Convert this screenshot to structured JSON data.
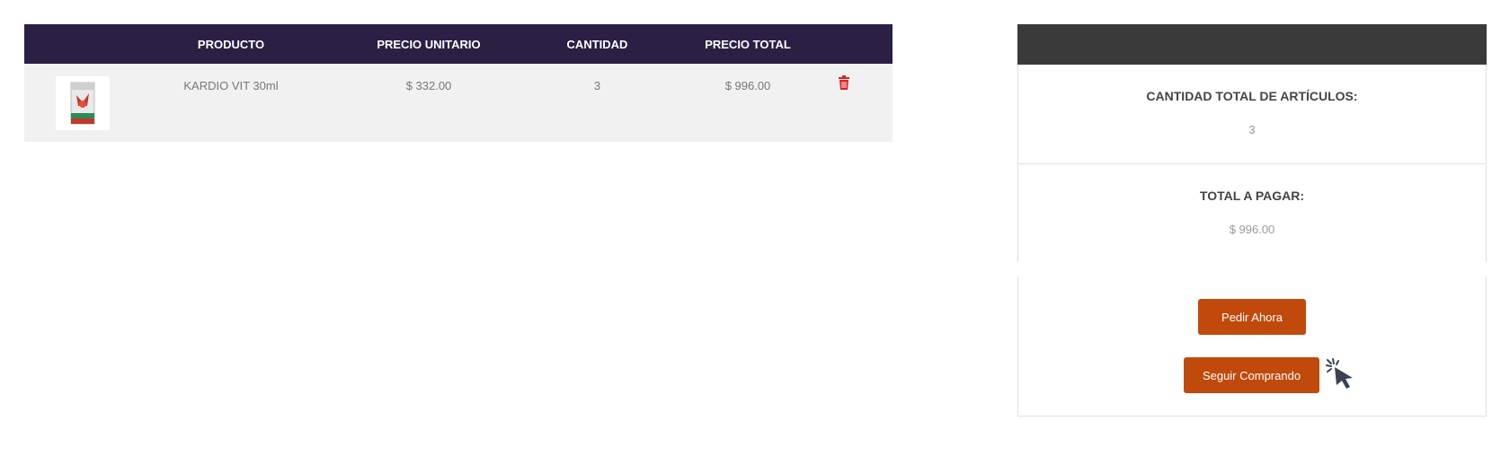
{
  "table": {
    "headers": {
      "producto": "PRODUCTO",
      "precio_unitario": "PRECIO UNITARIO",
      "cantidad": "CANTIDAD",
      "precio_total": "PRECIO TOTAL"
    },
    "rows": [
      {
        "product": "KARDIO VIT 30ml",
        "unit_price": "$ 332.00",
        "quantity": "3",
        "total_price": "$ 996.00"
      }
    ]
  },
  "summary": {
    "total_items_label": "CANTIDAD TOTAL DE ARTÍCULOS:",
    "total_items_value": "3",
    "total_pay_label": "TOTAL A PAGAR:",
    "total_pay_value": "$ 996.00",
    "order_button": "Pedir Ahora",
    "continue_button": "Seguir Comprando"
  },
  "colors": {
    "table_header_bg": "#2b1f44",
    "summary_header_bg": "#3a3a3a",
    "button_bg": "#c04a0b",
    "delete_icon": "#e02020",
    "row_bg": "#f1f1f1"
  },
  "icons": {
    "delete": "trash-icon",
    "cursor": "pointer-cursor-icon"
  }
}
